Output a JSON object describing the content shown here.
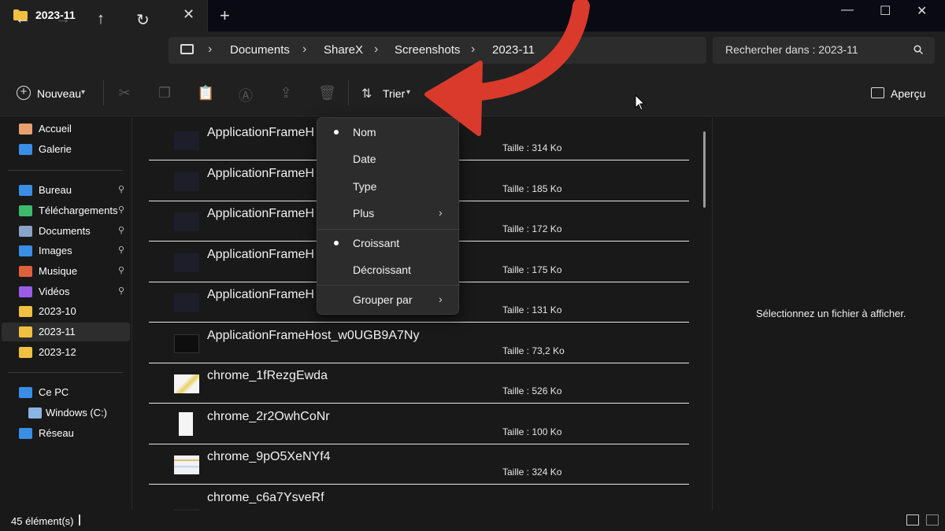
{
  "window": {
    "tab_title": "2023-11",
    "close_tab": "✕",
    "new_tab": "+",
    "minimize": "—",
    "maximize": "☐",
    "close": "✕"
  },
  "nav": {
    "back": "←",
    "forward": "→",
    "up": "↑",
    "refresh": "↻",
    "breadcrumbs": [
      "Documents",
      "ShareX",
      "Screenshots",
      "2023-11"
    ],
    "separator": "›",
    "search_placeholder": "Rechercher dans : 2023-11"
  },
  "toolbar": {
    "new_label": "Nouveau",
    "sort_label": "Trier",
    "preview_label": "Aperçu"
  },
  "sidebar": {
    "items": [
      {
        "label": "Accueil",
        "icon": "home-icon",
        "color": "#e8a070"
      },
      {
        "label": "Galerie",
        "icon": "gallery-icon",
        "color": "#3a8ee6"
      },
      {
        "label": "Bureau",
        "icon": "desktop-icon",
        "color": "#3a8ee6",
        "pinned": true
      },
      {
        "label": "Téléchargements",
        "icon": "download-icon",
        "color": "#3dbb6c",
        "pinned": true
      },
      {
        "label": "Documents",
        "icon": "documents-icon",
        "color": "#8aa4c8",
        "pinned": true
      },
      {
        "label": "Images",
        "icon": "images-icon",
        "color": "#3a8ee6",
        "pinned": true
      },
      {
        "label": "Musique",
        "icon": "music-icon",
        "color": "#e0603a",
        "pinned": true
      },
      {
        "label": "Vidéos",
        "icon": "videos-icon",
        "color": "#9a5ce6",
        "pinned": true
      },
      {
        "label": "2023-10",
        "icon": "folder-icon",
        "color": "#f2c040"
      },
      {
        "label": "2023-11",
        "icon": "folder-icon",
        "color": "#f2c040",
        "selected": true
      },
      {
        "label": "2023-12",
        "icon": "folder-icon",
        "color": "#f2c040"
      },
      {
        "label": "Ce PC",
        "icon": "pc-icon",
        "color": "#3a8ee6"
      },
      {
        "label": "Windows (C:)",
        "icon": "drive-icon",
        "color": "#8ab4e6"
      },
      {
        "label": "Réseau",
        "icon": "network-icon",
        "color": "#3a8ee6"
      }
    ],
    "pin_glyph": "📌"
  },
  "files": [
    {
      "name": "ApplicationFrameH",
      "size": "Taille : 314 Ko"
    },
    {
      "name": "ApplicationFrameH",
      "size": "Taille : 185 Ko"
    },
    {
      "name": "ApplicationFrameH",
      "size": "Taille : 172 Ko"
    },
    {
      "name": "ApplicationFrameH",
      "size": "Taille : 175 Ko"
    },
    {
      "name": "ApplicationFrameH",
      "size": "Taille : 131 Ko"
    },
    {
      "name": "ApplicationFrameHost_w0UGB9A7Ny",
      "size": "Taille : 73,2 Ko"
    },
    {
      "name": "chrome_1fRezgEwda",
      "size": "Taille : 526 Ko"
    },
    {
      "name": "chrome_2r2OwhCoNr",
      "size": "Taille : 100 Ko"
    },
    {
      "name": "chrome_9pO5XeNYf4",
      "size": "Taille : 324 Ko"
    },
    {
      "name": "chrome_c6a7YsveRf",
      "size": ""
    }
  ],
  "sort_menu": {
    "items": [
      {
        "label": "Nom",
        "checked": true
      },
      {
        "label": "Date"
      },
      {
        "label": "Type"
      },
      {
        "label": "Plus",
        "submenu": true
      },
      {
        "label": "Croissant",
        "checked": true
      },
      {
        "label": "Décroissant"
      },
      {
        "label": "Grouper par",
        "submenu": true
      }
    ],
    "submenu_arrow": "›"
  },
  "preview": {
    "empty_text": "Sélectionnez un fichier à afficher."
  },
  "status": {
    "item_count": "45 élément(s)"
  },
  "colors": {
    "annotation_arrow": "#d93a2b",
    "folder": "#f2c040"
  }
}
